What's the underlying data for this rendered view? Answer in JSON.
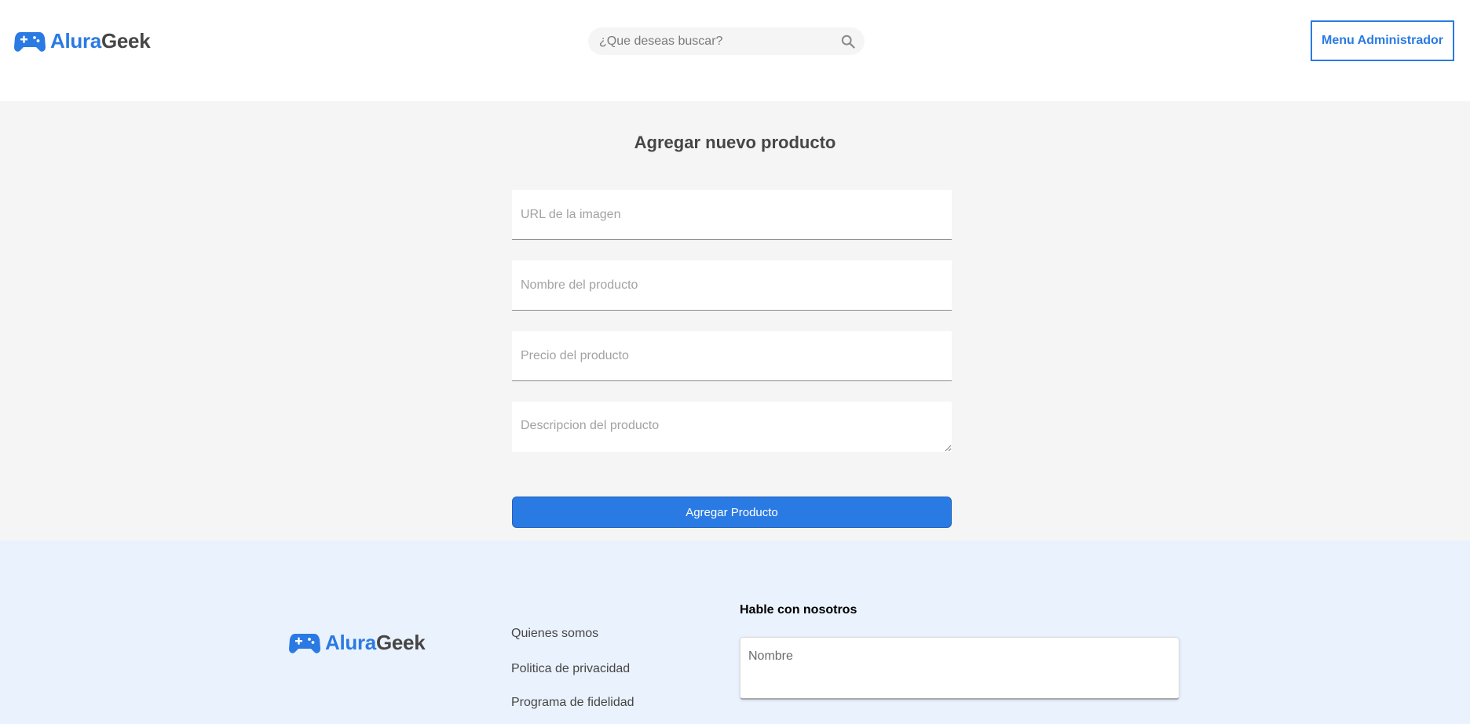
{
  "brand": {
    "part1": "Alura",
    "part2": "Geek",
    "icon": "gamepad-icon",
    "accent_color": "#2A7AE4",
    "text_color": "#464646"
  },
  "header": {
    "search": {
      "placeholder": "¿Que deseas buscar?",
      "icon": "search-icon"
    },
    "admin_button_label": "Menu Administrador"
  },
  "form": {
    "title": "Agregar nuevo producto",
    "fields": {
      "image_url_placeholder": "URL de la imagen",
      "name_placeholder": "Nombre del producto",
      "price_placeholder": "Precio del producto",
      "description_placeholder": "Descripcion del producto"
    },
    "submit_label": "Agregar Producto"
  },
  "footer": {
    "links": [
      "Quienes somos",
      "Politica de privacidad",
      "Programa de fidelidad"
    ],
    "contact": {
      "title": "Hable con nosotros",
      "name_placeholder": "Nombre"
    },
    "background_color": "#EAF2FD"
  }
}
